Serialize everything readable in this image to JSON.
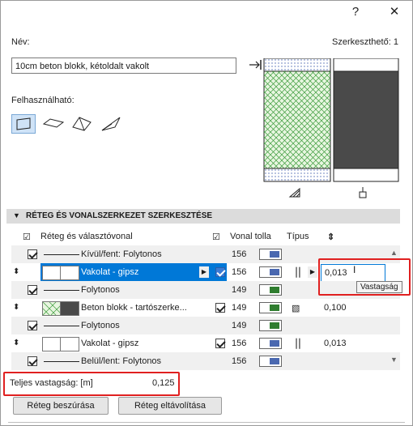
{
  "titlebar": {
    "help_label": "?",
    "close_label": "✕"
  },
  "name": {
    "label": "Név:",
    "value": "10cm beton blokk, kétoldalt vakolt"
  },
  "editable": {
    "label": "Szerkeszthető: 1"
  },
  "usable": {
    "label": "Felhasználható:"
  },
  "section": {
    "title": "RÉTEG ÉS VONALSZERKEZET SZERKESZTÉSE"
  },
  "grid": {
    "headers": {
      "layer": "Réteg és választóvonal",
      "pen": "Vonal tolla",
      "type": "Típus",
      "thickness_icon": "⇕"
    },
    "rows": [
      {
        "kind": "line",
        "text": "Kívül/fent: Folytonos",
        "pen": "156",
        "pen_color": "#4a68b0"
      },
      {
        "kind": "layer",
        "text": "Vakolat - gipsz",
        "pen": "156",
        "pen_color": "#4a68b0",
        "thickness": "0,013"
      },
      {
        "kind": "line",
        "text": "Folytonos",
        "pen": "149",
        "pen_color": "#2f7d2f"
      },
      {
        "kind": "layer",
        "text": "Beton blokk - tartószerke...",
        "pen": "149",
        "pen_color": "#2f7d2f",
        "thickness": "0,100"
      },
      {
        "kind": "line",
        "text": "Folytonos",
        "pen": "149",
        "pen_color": "#2f7d2f"
      },
      {
        "kind": "layer",
        "text": "Vakolat - gipsz",
        "pen": "156",
        "pen_color": "#4a68b0",
        "thickness": "0,013"
      },
      {
        "kind": "line",
        "text": "Belül/lent: Folytonos",
        "pen": "156",
        "pen_color": "#4a68b0"
      }
    ]
  },
  "tooltip": {
    "text": "Vastagság"
  },
  "total": {
    "label": "Teljes vastagság: [m]",
    "value": "0,125"
  },
  "buttons": {
    "insert": "Réteg beszúrása",
    "remove": "Réteg eltávolítása"
  },
  "colors": {
    "accent": "#0078d7",
    "highlight": "#e02020",
    "fill_dark": "#4a4a4a",
    "fill_green": "#2f8a2f"
  }
}
